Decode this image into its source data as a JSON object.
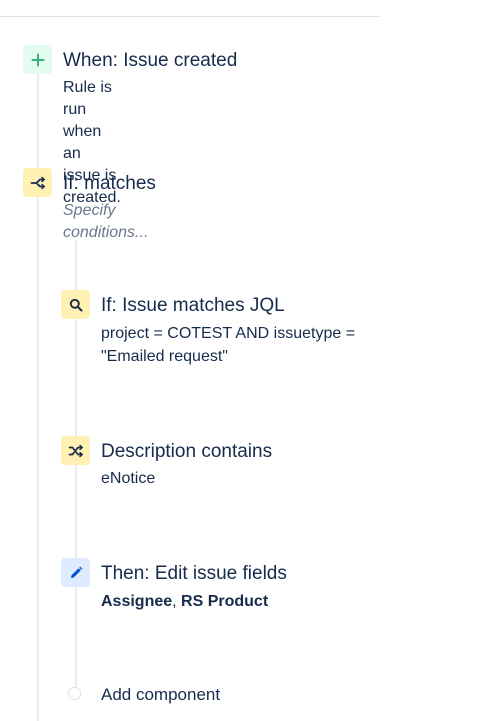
{
  "steps": {
    "trigger": {
      "title": "When: Issue created",
      "description": "Rule is run when an issue is created.",
      "icon": "plus-icon",
      "icon_bg": "#e3fcef",
      "icon_color": "#36b37e"
    },
    "condition": {
      "title": "If: matches",
      "description": "Specify conditions...",
      "icon": "branch-icon",
      "icon_bg": "#fff0b3",
      "icon_color": "#172b4d"
    },
    "jql": {
      "title": "If: Issue matches JQL",
      "description_line1": "project = COTEST AND issuetype =",
      "description_line2": "\"Emailed request\"",
      "icon": "search-icon",
      "icon_bg": "#fff0b3",
      "icon_color": "#172b4d"
    },
    "desc_contains": {
      "title": "Description contains",
      "description": "eNotice",
      "icon": "shuffle-icon",
      "icon_bg": "#fff0b3",
      "icon_color": "#172b4d"
    },
    "action": {
      "title": "Then: Edit issue fields",
      "field1": "Assignee",
      "separator": ", ",
      "field2": "RS Product",
      "icon": "pencil-icon",
      "icon_bg": "#deebff",
      "icon_color": "#0052cc"
    }
  },
  "add_component": {
    "label": "Add component"
  }
}
